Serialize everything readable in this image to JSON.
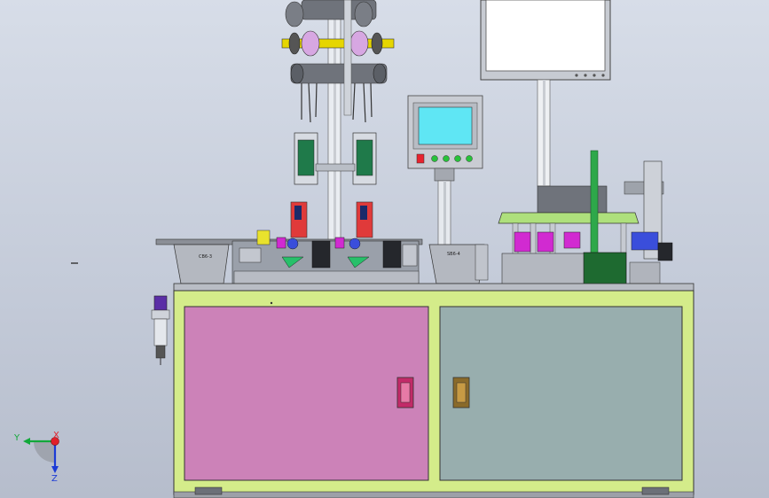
{
  "colors": {
    "background_top": "#d7dde8",
    "background_bottom": "#b6bdcc",
    "frame": "#d4ec8a",
    "left_door": "#cc82b8",
    "right_door": "#98aeae",
    "hmi_screen": "#5fe6f4",
    "green_table": "#aee07c"
  },
  "labels": {
    "left_tray": "CB6-3",
    "right_tray": "SB6-4"
  },
  "axes": {
    "y": "Y",
    "z": "Z",
    "x": "X"
  },
  "icons": {
    "hmi_buttons": [
      "red-button",
      "green-button",
      "green-button",
      "green-button",
      "green-button"
    ],
    "door_handles": [
      "magenta-handle",
      "brown-handle"
    ]
  }
}
